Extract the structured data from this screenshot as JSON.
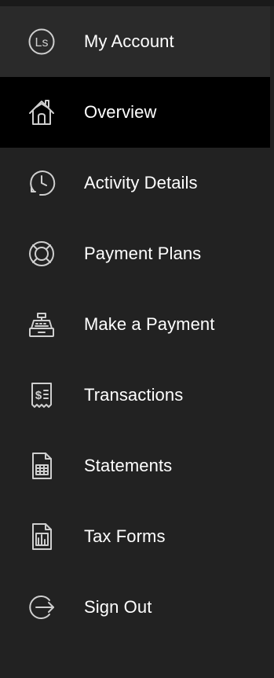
{
  "sidebar": {
    "items": [
      {
        "label": "My Account",
        "icon": "account-initials-icon",
        "initials": "Ls"
      },
      {
        "label": "Overview",
        "icon": "home-icon",
        "active": true
      },
      {
        "label": "Activity Details",
        "icon": "clock-history-icon"
      },
      {
        "label": "Payment Plans",
        "icon": "lifebuoy-icon"
      },
      {
        "label": "Make a Payment",
        "icon": "cash-register-icon"
      },
      {
        "label": "Transactions",
        "icon": "receipt-dollar-icon",
        "icon_text": "$"
      },
      {
        "label": "Statements",
        "icon": "document-table-icon"
      },
      {
        "label": "Tax Forms",
        "icon": "document-chart-icon"
      },
      {
        "label": "Sign Out",
        "icon": "sign-out-icon"
      }
    ]
  },
  "colors": {
    "background": "#222222",
    "active_background": "#000000",
    "text": "#ffffff",
    "icon": "#cfcfcf"
  }
}
